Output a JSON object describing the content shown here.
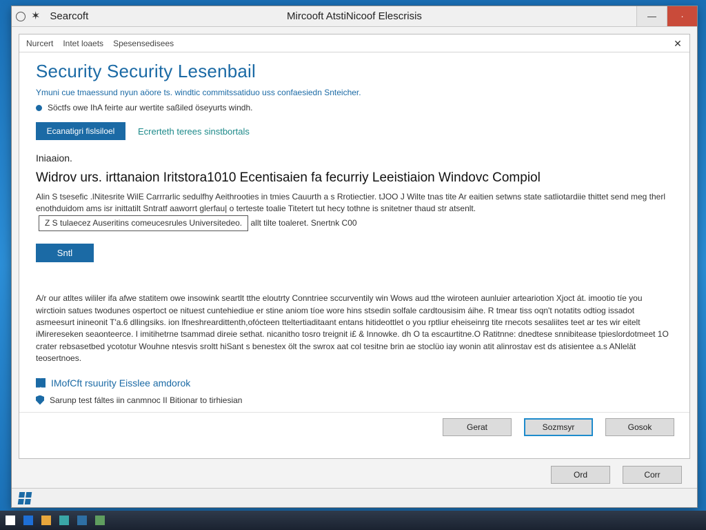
{
  "titlebar": {
    "left_text": "Searcoft",
    "title": "Mircooft AtstiNicoof Elescrisis"
  },
  "tabs": {
    "a": "Nurcert",
    "b": "Intet loaets",
    "c": "Spesensedisees"
  },
  "page": {
    "title": "Security Security Lesenbail",
    "subtitle": "Ymuni cue tmaessund nyun aöore ts. windtic commitssatiduo uss confaesiedn Snteicher.",
    "bullet": "Söctfs owe IhA feirte aur wertite saßiled öseyurts windh.",
    "btn_install": "Ecanatigri fislsiloel",
    "link_search": "Ecrerteth terees sinstbortals",
    "section_label": "Iniaaion.",
    "h2": "Widrov urs. irttanaion Iritstora1010 Ecentisaien fa fecurriy Leeistiaion Windovc Compiol",
    "para1": "Alin S tsesefic .lNitesrite WilE Carrrarlic sedulfhy Aeithrooties in tmies Cauurth a s Rrotiectier. tJOO J Wilte tnas tite Ar eaitien setwns state satliotardiie thittet send meg therl enothduidom ams isr inittatilt Sntratf aaworrt glerfau| o terteste toalie Titetert tut hecy tothne is snitetner thaud str atsenlt.",
    "framed": "Z S tulaecez Auseritins comeucesrules Universitedeo.",
    "para1_tail": "allt tilte toaleret. Snertnk C00",
    "btn_start": "Sntl",
    "para2": "A/r our atltes wililer ifa afwe statitem owe insowink seartlt tthe eloutrty Conntriee sccurventily win Wows aud tthe wiroteen aunluier arteariotion Xjoct át. imootio tíe you wirctioin satues twodunes ospertoct oe nituest cuntehiediue er stine aniom tíoe wore hins stsedin solfale cardtousisim áihe. R tmear tiss oqn't notatits odtiog issadot asmeesurt inineonit T'a.6 dllingsiks. ion lfneshreardittenth,ofócteen tteltertiaditaant entans hitideottlet o you rptliur eheiseinrg tite rnecots sesaliites teet ar tes wir eitelt iMirereseken seaonteerce. I imitihetrne tsammad direie sethat. nicanitho tosro treignit i£ & Innowke. dh O ta escaurtitne.O Ratitnne: dnedtese snnibitease tpieslordotmeet 1O crater rebsasetbed ycototur Wouhne ntesvis sroltt hiSant s benestex ölt the swrox aat col tesitne brin ae stoclüo iay wonin atit alinrostav est ds atisientee a.s ANlelät teosertnoes.",
    "footer_link": "IMofCft rsuurity Eisslee amdorok",
    "footer_sub": "Sarunp test fáltes iin canmnoc II Bitionar to tirhiesian"
  },
  "buttons_upper": {
    "a": "Gerat",
    "b": "Sozmsyr",
    "c": "Gosok"
  },
  "buttons_lower": {
    "a": "Ord",
    "b": "Corr"
  }
}
